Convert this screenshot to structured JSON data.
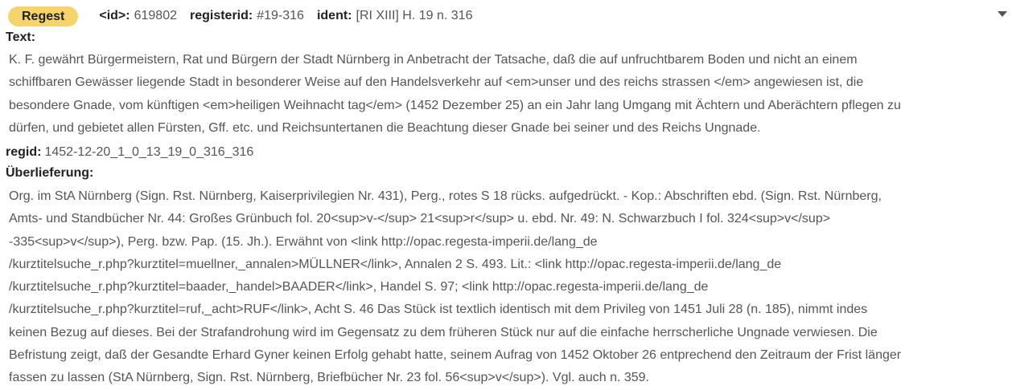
{
  "header": {
    "badge": "Regest",
    "id_label": "<id>:",
    "id_value": "619802",
    "registerid_label": "registerid:",
    "registerid_value": "#19-316",
    "ident_label": "ident:",
    "ident_value": "[RI XIII] H. 19 n. 316"
  },
  "text": {
    "label": "Text:",
    "lines": [
      "K. F. gewährt Bürgermeistern, Rat und Bürgern der Stadt Nürnberg in Anbetracht der Tatsache, daß die auf unfruchtbarem Boden und nicht an einem",
      "schiffbaren Gewässer liegende Stadt in besonderer Weise auf den Handelsverkehr auf <em>unser und des reichs strassen </em> angewiesen ist, die",
      "besondere Gnade, vom künftigen <em>heiligen Weihnacht tag</em> (1452 Dezember 25) an ein Jahr lang Umgang mit Ächtern und Aberächtern pflegen zu",
      "dürfen, und gebietet allen Fürsten, Gff. etc. und Reichsuntertanen die Beachtung dieser Gnade bei seiner und des Reichs Ungnade."
    ]
  },
  "regid": {
    "label": "regid:",
    "value": "1452-12-20_1_0_13_19_0_316_316"
  },
  "ueberlieferung": {
    "label": "Überlieferung:",
    "lines": [
      "Org. im StA Nürnberg (Sign. Rst. Nürnberg, Kaiserprivilegien Nr. 431), Perg., rotes S 18 rücks. aufgedrückt. - Kop.: Abschriften ebd. (Sign. Rst. Nürnberg,",
      "Amts- und Standbücher Nr. 44: Großes Grünbuch fol. 20<sup>v-</sup> 21<sup>r</sup> u. ebd. Nr. 49: N. Schwarzbuch I fol. 324<sup>v</sup>",
      "-335<sup>v</sup>), Perg. bzw. Pap. (15. Jh.). Erwähnt von <link http://opac.regesta-imperii.de/lang_de",
      "/kurztitelsuche_r.php?kurztitel=muellner,_annalen>MÜLLNER</link>, Annalen 2 S. 493. Lit.: <link http://opac.regesta-imperii.de/lang_de",
      "/kurztitelsuche_r.php?kurztitel=baader,_handel>BAADER</link>, Handel S. 97; <link http://opac.regesta-imperii.de/lang_de",
      "/kurztitelsuche_r.php?kurztitel=ruf,_acht>RUF</link>, Acht S. 46 Das Stück ist textlich identisch mit dem Privileg von 1451 Juli 28 (n. 185), nimmt indes",
      "keinen Bezug auf dieses. Bei der Strafandrohung wird im Gegensatz zu dem früheren Stück nur auf die einfache herrscherliche Ungnade verwiesen. Die",
      "Befristung zeigt, daß der Gesandte Erhard Gyner keinen Erfolg gehabt hatte, seinem Aufrag von 1452 Oktober 26 entprechend den Zeitraum der Frist länger",
      "fassen zu lassen (StA Nürnberg, Sign. Rst. Nürnberg, Briefbücher Nr. 23 fol. 56<sup>v</sup>). Vgl. auch n. 359."
    ]
  },
  "icons": {
    "collapse": "chevron-down-icon"
  },
  "colors": {
    "badge_bg": "#f6d36b",
    "label_text": "#222222",
    "value_text": "#555555"
  }
}
